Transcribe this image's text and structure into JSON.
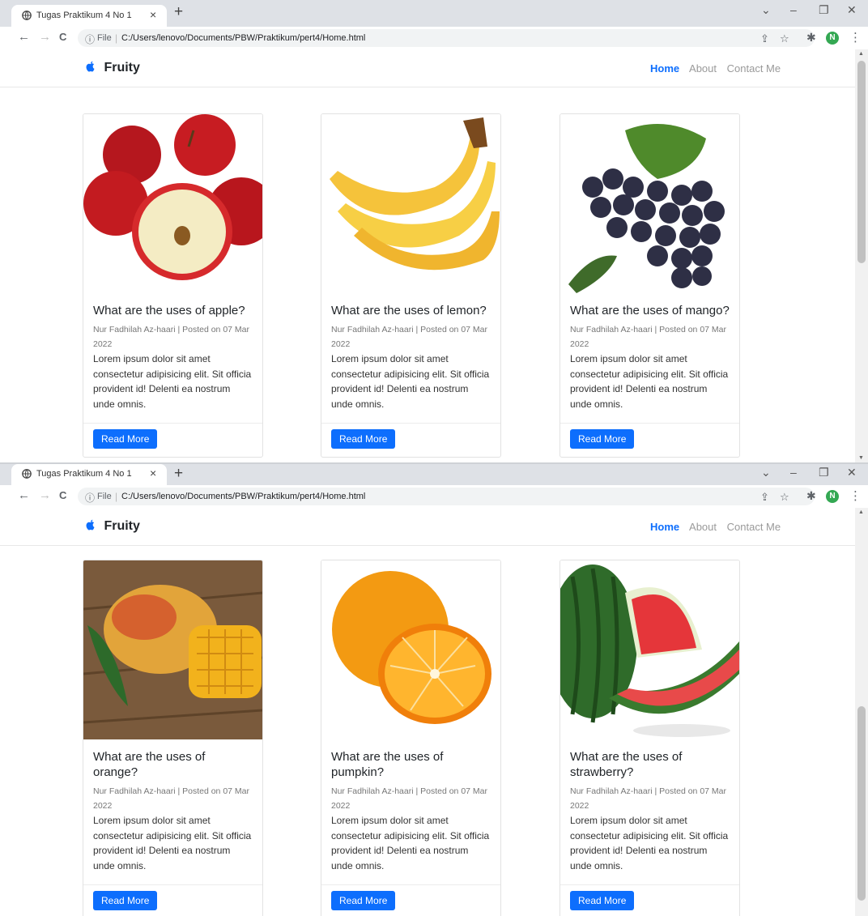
{
  "browser": {
    "tab_title": "Tugas Praktikum 4 No 1",
    "tab_close": "×",
    "new_tab": "+",
    "scheme": "File",
    "url": "C:/Users/lenovo/Documents/PBW/Praktikum/pert4/Home.html",
    "avatar_letter": "N",
    "controls": {
      "dropdown": "⌄",
      "minimize": "–",
      "restore": "❐",
      "close": "✕"
    },
    "nav": {
      "back": "←",
      "forward": "→",
      "reload": "C"
    }
  },
  "site": {
    "brand": "Fruity",
    "nav_links": [
      "Home",
      "About",
      "Contact Me"
    ]
  },
  "cards_top": [
    {
      "title": "What are the uses of apple?",
      "meta": "Nur Fadhilah Az-haari | Posted on 07 Mar 2022",
      "text": "Lorem ipsum dolor sit amet consectetur adipisicing elit. Sit officia provident id! Delenti ea nostrum unde omnis.",
      "button": "Read More",
      "image": "apple"
    },
    {
      "title": "What are the uses of lemon?",
      "meta": "Nur Fadhilah Az-haari | Posted on 07 Mar 2022",
      "text": "Lorem ipsum dolor sit amet consectetur adipisicing elit. Sit officia provident id! Delenti ea nostrum unde omnis.",
      "button": "Read More",
      "image": "banana"
    },
    {
      "title": "What are the uses of mango?",
      "meta": "Nur Fadhilah Az-haari | Posted on 07 Mar 2022",
      "text": "Lorem ipsum dolor sit amet consectetur adipisicing elit. Sit officia provident id! Delenti ea nostrum unde omnis.",
      "button": "Read More",
      "image": "grapes"
    }
  ],
  "cards_bottom": [
    {
      "title": "What are the uses of orange?",
      "meta": "Nur Fadhilah Az-haari | Posted on 07 Mar 2022",
      "text": "Lorem ipsum dolor sit amet consectetur adipisicing elit. Sit officia provident id! Delenti ea nostrum unde omnis.",
      "button": "Read More",
      "image": "mango"
    },
    {
      "title": "What are the uses of pumpkin?",
      "meta": "Nur Fadhilah Az-haari | Posted on 07 Mar 2022",
      "text": "Lorem ipsum dolor sit amet consectetur adipisicing elit. Sit officia provident id! Delenti ea nostrum unde omnis.",
      "button": "Read More",
      "image": "orange"
    },
    {
      "title": "What are the uses of strawberry?",
      "meta": "Nur Fadhilah Az-haari | Posted on 07 Mar 2022",
      "text": "Lorem ipsum dolor sit amet consectetur adipisicing elit. Sit officia provident id! Delenti ea nostrum unde omnis.",
      "button": "Read More",
      "image": "watermelon"
    }
  ],
  "colors": {
    "primary": "#0d6efd",
    "tabstrip": "#dee1e6",
    "avatar": "#34a853"
  }
}
